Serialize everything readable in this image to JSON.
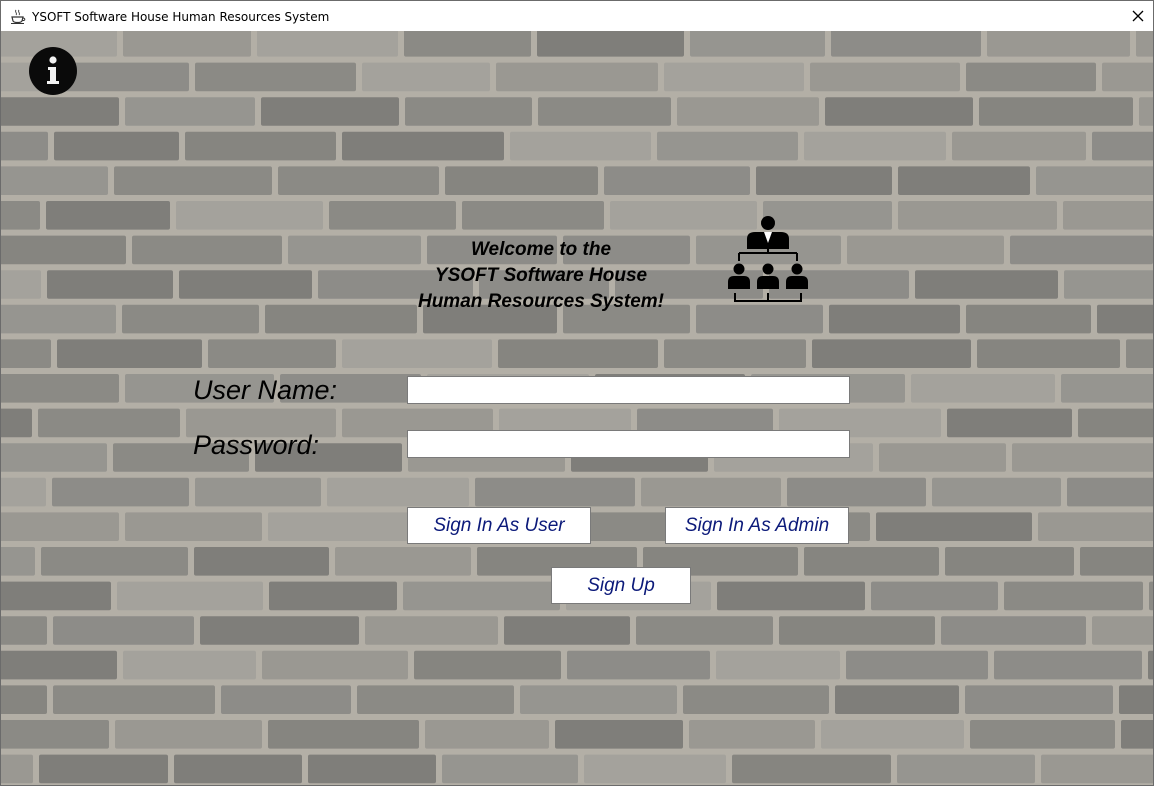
{
  "window": {
    "title": "YSOFT Software House Human Resources System",
    "icon": "java-cup-icon",
    "close_glyph": "✕"
  },
  "info_button": {
    "glyph": "i",
    "icon": "info-icon"
  },
  "welcome": {
    "line1": "Welcome to the",
    "line2": "YSOFT Software House",
    "line3": "Human Resources System!"
  },
  "hr_icon": "org-chart-icon",
  "form": {
    "username_label": "User Name:",
    "username_value": "",
    "password_label": "Password:",
    "password_value": ""
  },
  "buttons": {
    "sign_in_user": "Sign In As User",
    "sign_in_admin": "Sign In As Admin",
    "sign_up": "Sign Up"
  },
  "colors": {
    "mortar": "#b3afa6",
    "brick_palette": [
      "#8d8c88",
      "#9a9892",
      "#7f7e7a",
      "#a4a29c",
      "#868580",
      "#969590",
      "#8b8a85"
    ],
    "button_text": "#0c1a7a",
    "info_button_bg": "#0a0a0a"
  }
}
